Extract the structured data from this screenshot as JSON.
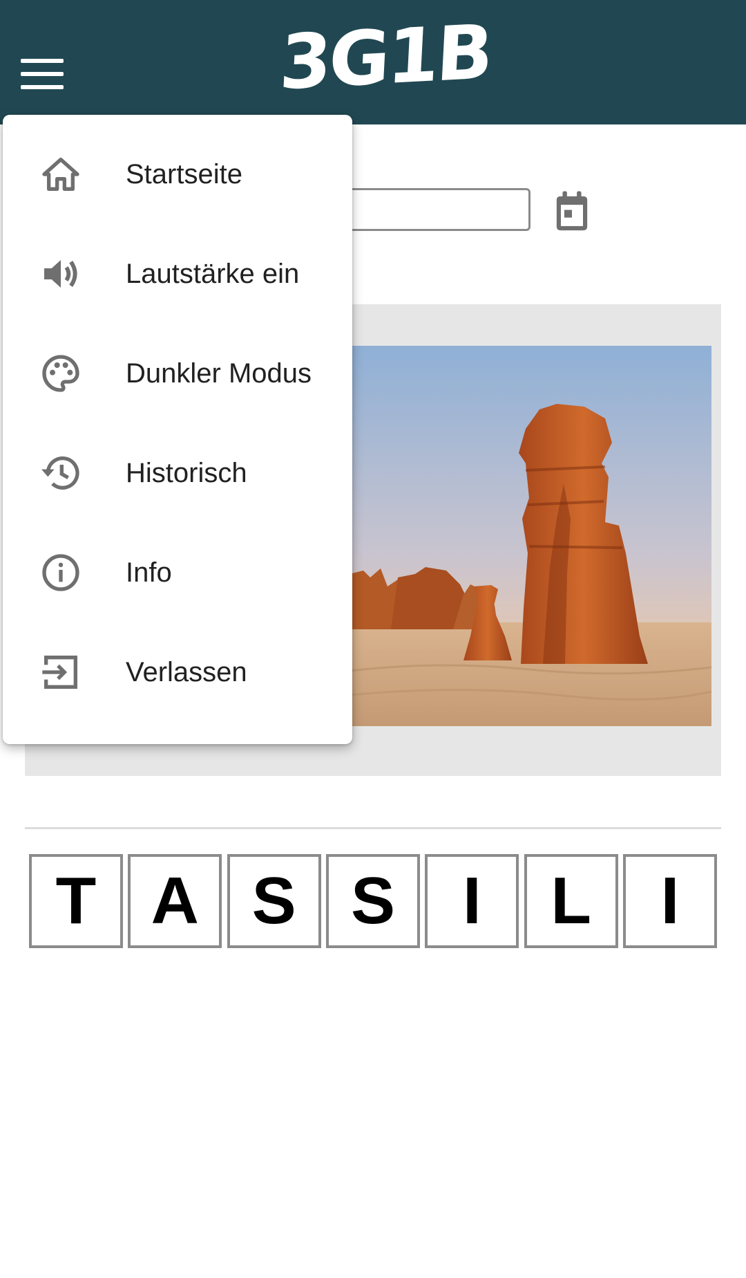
{
  "header": {
    "logo": "3G1B",
    "background_color": "#214852",
    "menu_icon": "hamburger-menu-icon"
  },
  "date_picker": {
    "value": "",
    "calendar_icon": "calendar-icon"
  },
  "puzzle": {
    "image_description_icon": "desert-rock-photo",
    "letters": [
      "T",
      "A",
      "S",
      "S",
      "I",
      "L",
      "I"
    ]
  },
  "menu": {
    "items": [
      {
        "label": "Startseite",
        "icon": "home-icon"
      },
      {
        "label": "Lautstärke ein",
        "icon": "volume-icon"
      },
      {
        "label": "Dunkler Modus",
        "icon": "palette-icon"
      },
      {
        "label": "Historisch",
        "icon": "history-icon"
      },
      {
        "label": "Info",
        "icon": "info-icon"
      },
      {
        "label": "Verlassen",
        "icon": "exit-icon"
      }
    ]
  }
}
